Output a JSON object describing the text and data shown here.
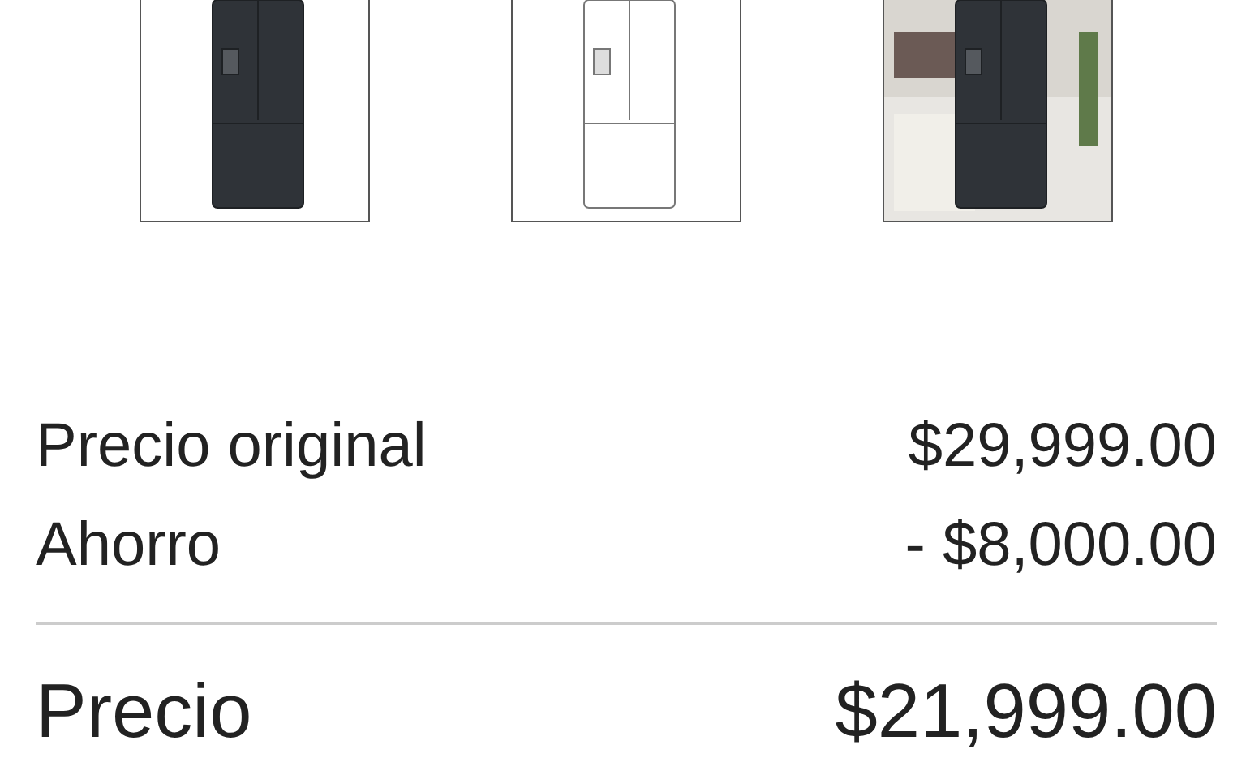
{
  "price_rows": [
    {
      "label": "Precio original",
      "value": "$29,999.00"
    },
    {
      "label": "Ahorro",
      "value": "- $8,000.00"
    }
  ],
  "total": {
    "label": "Precio",
    "value": "$21,999.00"
  }
}
